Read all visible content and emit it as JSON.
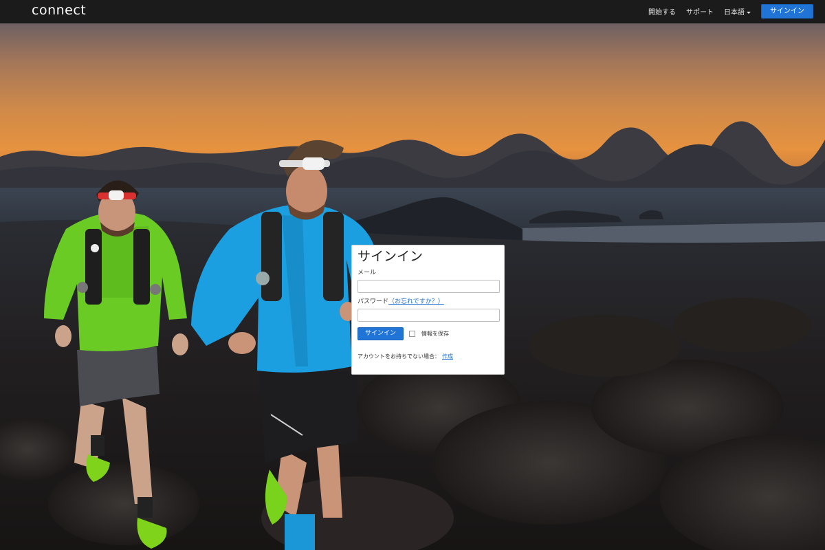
{
  "navbar": {
    "brand": "connect",
    "links": {
      "get_started": "開始する",
      "support": "サポート",
      "language": "日本語"
    },
    "signin_button": "サインイン"
  },
  "signin_form": {
    "title": "サインイン",
    "email_label": "メール",
    "email_value": "",
    "password_label": "パスワード",
    "forgot_link": "（お忘れですか？）",
    "password_value": "",
    "submit_label": "サインイン",
    "remember_label": "情報を保存",
    "remember_checked": false,
    "no_account_text": "アカウントをお持ちでない場合：",
    "create_link": "作成"
  },
  "colors": {
    "navbar_bg": "#1b1b1b",
    "accent": "#1f74d6",
    "link": "#1f6fd0"
  },
  "icons": {
    "language_dropdown": "caret-down-icon"
  }
}
